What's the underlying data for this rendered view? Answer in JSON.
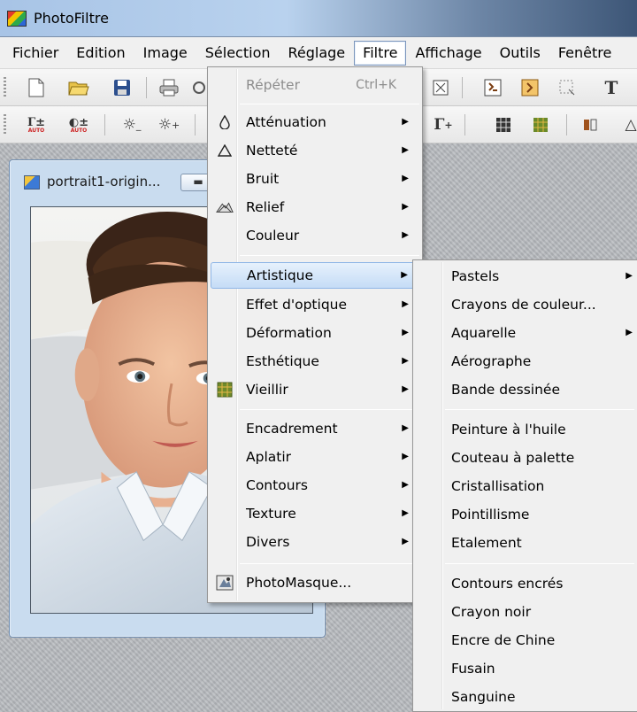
{
  "app": {
    "title": "PhotoFiltre"
  },
  "menubar": {
    "items": [
      {
        "label": "Fichier"
      },
      {
        "label": "Edition"
      },
      {
        "label": "Image"
      },
      {
        "label": "Sélection"
      },
      {
        "label": "Réglage"
      },
      {
        "label": "Filtre",
        "active": true
      },
      {
        "label": "Affichage"
      },
      {
        "label": "Outils"
      },
      {
        "label": "Fenêtre"
      }
    ]
  },
  "document": {
    "title": "portrait1-origin...",
    "minimize_label": "▬"
  },
  "filtre_menu": {
    "items": [
      {
        "label": "Répéter",
        "shortcut": "Ctrl+K",
        "disabled": true
      },
      {
        "label": "Atténuation",
        "icon": "drop-icon",
        "submenu": true
      },
      {
        "label": "Netteté",
        "icon": "triangle-icon",
        "submenu": true
      },
      {
        "label": "Bruit",
        "submenu": true
      },
      {
        "label": "Relief",
        "icon": "relief-icon",
        "submenu": true
      },
      {
        "label": "Couleur",
        "submenu": true
      },
      {
        "label": "Artistique",
        "submenu": true,
        "highlighted": true
      },
      {
        "label": "Effet d'optique",
        "submenu": true
      },
      {
        "label": "Déformation",
        "submenu": true
      },
      {
        "label": "Esthétique",
        "submenu": true
      },
      {
        "label": "Vieillir",
        "icon": "vieillir-icon",
        "submenu": true
      },
      {
        "label": "Encadrement",
        "submenu": true
      },
      {
        "label": "Aplatir",
        "submenu": true
      },
      {
        "label": "Contours",
        "submenu": true
      },
      {
        "label": "Texture",
        "submenu": true
      },
      {
        "label": "Divers",
        "submenu": true
      },
      {
        "label": "PhotoMasque...",
        "icon": "photomasque-icon"
      }
    ]
  },
  "artistique_submenu": {
    "items": [
      {
        "label": "Pastels",
        "submenu": true
      },
      {
        "label": "Crayons de couleur..."
      },
      {
        "label": "Aquarelle",
        "submenu": true
      },
      {
        "label": "Aérographe"
      },
      {
        "label": "Bande dessinée"
      },
      {
        "label": "Peinture à l'huile"
      },
      {
        "label": "Couteau à palette"
      },
      {
        "label": "Cristallisation"
      },
      {
        "label": "Pointillisme"
      },
      {
        "label": "Etalement"
      },
      {
        "label": "Contours encrés"
      },
      {
        "label": "Crayon noir"
      },
      {
        "label": "Encre de Chine"
      },
      {
        "label": "Fusain"
      },
      {
        "label": "Sanguine"
      }
    ]
  },
  "colors": {
    "highlight": "#c5dcf6",
    "menu_bg": "#f0f0f0",
    "workspace": "#b6b9bd"
  }
}
